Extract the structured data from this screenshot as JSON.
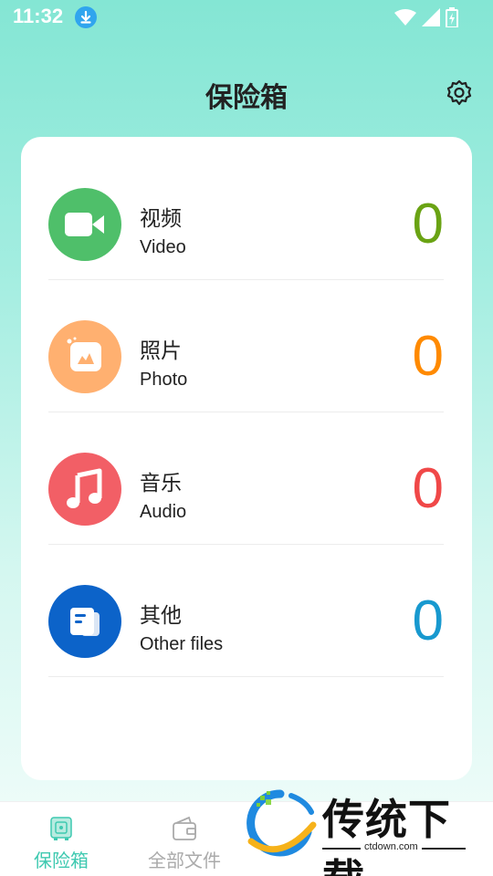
{
  "status_bar": {
    "time": "11:32"
  },
  "header": {
    "title": "保险箱"
  },
  "categories": [
    {
      "title_cn": "视频",
      "title_en": "Video",
      "count": "0",
      "icon": "video-camera-icon",
      "circle_color": "#4fbf6a",
      "count_color": "#6aa314"
    },
    {
      "title_cn": "照片",
      "title_en": "Photo",
      "count": "0",
      "icon": "photo-icon",
      "circle_color": "#ffb070",
      "count_color": "#ff8a00"
    },
    {
      "title_cn": "音乐",
      "title_en": "Audio",
      "count": "0",
      "icon": "music-note-icon",
      "circle_color": "#f25f66",
      "count_color": "#f04848"
    },
    {
      "title_cn": "其他",
      "title_en": "Other files",
      "count": "0",
      "icon": "document-icon",
      "circle_color": "#0c63c9",
      "count_color": "#1899cf"
    }
  ],
  "bottom_nav": {
    "items": [
      {
        "label": "保险箱",
        "active": true,
        "color": "#3ec9b0"
      },
      {
        "label": "全部文件",
        "active": false,
        "color": "#aaaaaa"
      }
    ]
  },
  "watermark": {
    "title": "传统下载",
    "url": "ctdown.com"
  }
}
